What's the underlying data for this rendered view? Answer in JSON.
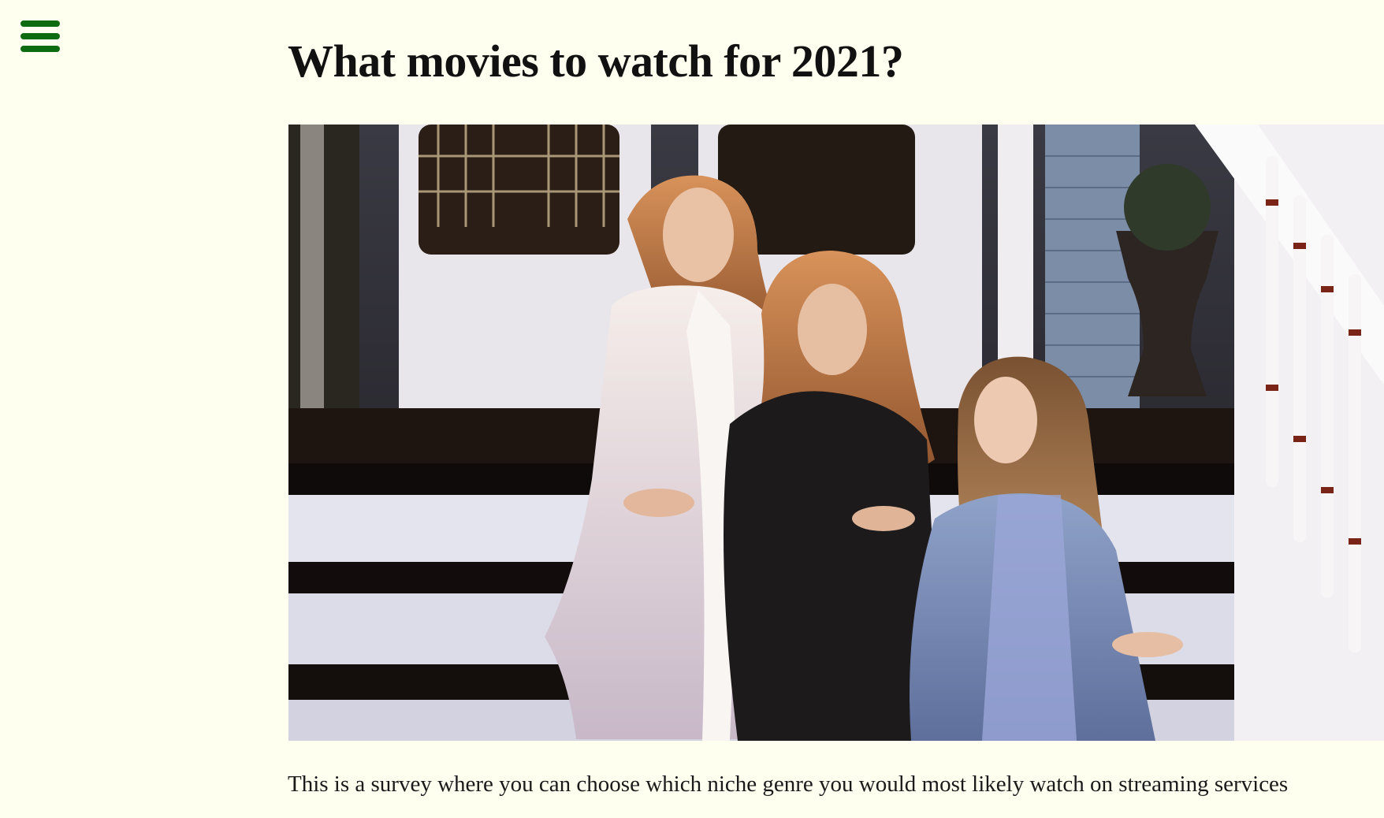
{
  "nav": {
    "menu_icon": "hamburger-menu-icon",
    "accent_color": "#0f6b12"
  },
  "article": {
    "title": "What movies to watch for 2021?",
    "hero_image": {
      "subject": "three-women-on-porch-steps"
    },
    "intro": "This is a survey where you can choose which niche genre you would most likely watch on streaming services"
  },
  "colors": {
    "background": "#fffff0",
    "text": "#111111"
  }
}
